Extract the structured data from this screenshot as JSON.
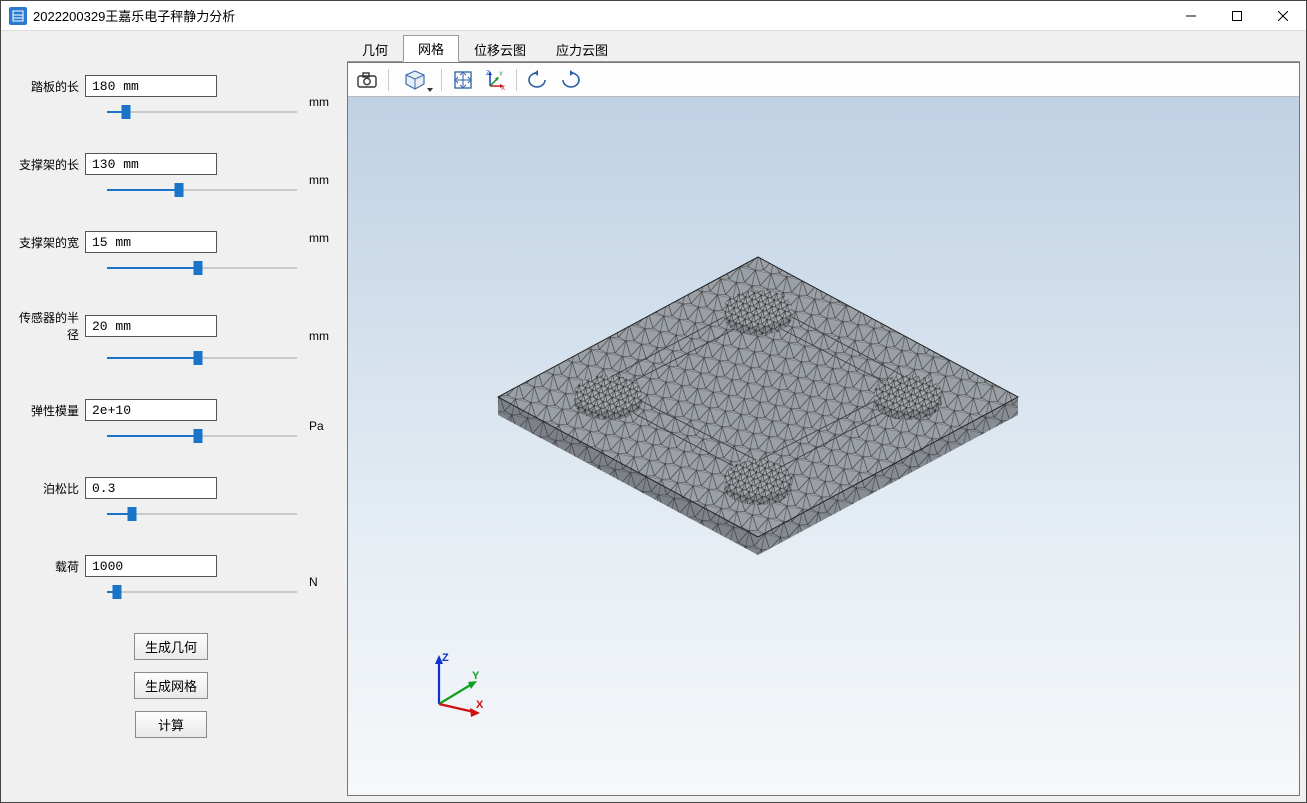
{
  "window": {
    "title": "2022200329王嘉乐电子秤静力分析"
  },
  "tabs": {
    "items": [
      "几何",
      "网格",
      "位移云图",
      "应力云图"
    ],
    "active_index": 1
  },
  "params": [
    {
      "label": "踏板的长",
      "value": "180 mm",
      "unit": "mm",
      "unit_pos": "bottom",
      "fill_pct": 10
    },
    {
      "label": "支撑架的长",
      "value": "130 mm",
      "unit": "mm",
      "unit_pos": "bottom",
      "fill_pct": 38
    },
    {
      "label": "支撑架的宽",
      "value": "15 mm",
      "unit": "mm",
      "unit_pos": "top",
      "fill_pct": 48
    },
    {
      "label": "传感器的半径",
      "value": "20 mm",
      "unit": "mm",
      "unit_pos": "bottom",
      "fill_pct": 48
    },
    {
      "label": "弹性模量",
      "value": "2e+10",
      "unit": "Pa",
      "unit_pos": "bottom",
      "fill_pct": 48
    },
    {
      "label": "泊松比",
      "value": "0.3",
      "unit": "",
      "unit_pos": "bottom",
      "fill_pct": 13
    },
    {
      "label": "载荷",
      "value": "1000",
      "unit": "N",
      "unit_pos": "bottom",
      "fill_pct": 5
    }
  ],
  "buttons": {
    "gen_geometry": "生成几何",
    "gen_mesh": "生成网格",
    "compute": "计算"
  },
  "toolbar_icons": {
    "camera": "camera-icon",
    "isoview": "iso-cube-icon",
    "fit": "fit-view-icon",
    "axes": "axes-toggle-icon",
    "rot_left": "rotate-left-icon",
    "rot_right": "rotate-right-icon"
  },
  "triad": {
    "x": "X",
    "y": "Y",
    "z": "Z"
  }
}
